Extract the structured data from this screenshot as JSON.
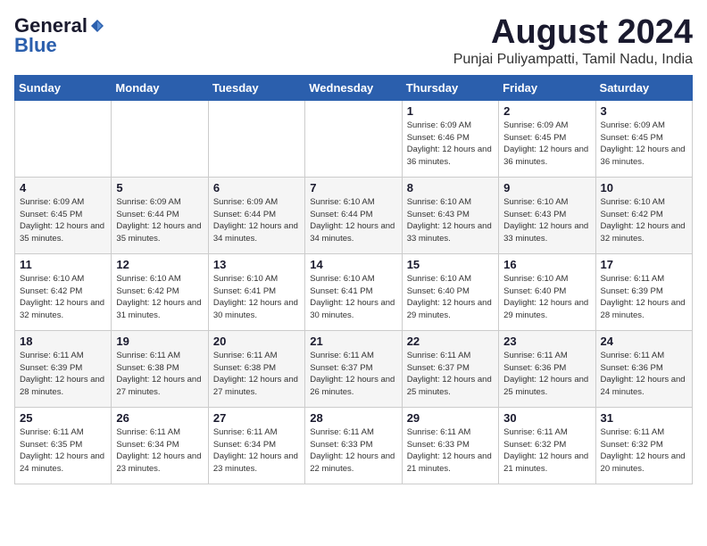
{
  "logo": {
    "general": "General",
    "blue": "Blue"
  },
  "title": "August 2024",
  "subtitle": "Punjai Puliyampatti, Tamil Nadu, India",
  "days_of_week": [
    "Sunday",
    "Monday",
    "Tuesday",
    "Wednesday",
    "Thursday",
    "Friday",
    "Saturday"
  ],
  "weeks": [
    [
      {
        "day": "",
        "info": ""
      },
      {
        "day": "",
        "info": ""
      },
      {
        "day": "",
        "info": ""
      },
      {
        "day": "",
        "info": ""
      },
      {
        "day": "1",
        "info": "Sunrise: 6:09 AM\nSunset: 6:46 PM\nDaylight: 12 hours\nand 36 minutes."
      },
      {
        "day": "2",
        "info": "Sunrise: 6:09 AM\nSunset: 6:45 PM\nDaylight: 12 hours\nand 36 minutes."
      },
      {
        "day": "3",
        "info": "Sunrise: 6:09 AM\nSunset: 6:45 PM\nDaylight: 12 hours\nand 36 minutes."
      }
    ],
    [
      {
        "day": "4",
        "info": "Sunrise: 6:09 AM\nSunset: 6:45 PM\nDaylight: 12 hours\nand 35 minutes."
      },
      {
        "day": "5",
        "info": "Sunrise: 6:09 AM\nSunset: 6:44 PM\nDaylight: 12 hours\nand 35 minutes."
      },
      {
        "day": "6",
        "info": "Sunrise: 6:09 AM\nSunset: 6:44 PM\nDaylight: 12 hours\nand 34 minutes."
      },
      {
        "day": "7",
        "info": "Sunrise: 6:10 AM\nSunset: 6:44 PM\nDaylight: 12 hours\nand 34 minutes."
      },
      {
        "day": "8",
        "info": "Sunrise: 6:10 AM\nSunset: 6:43 PM\nDaylight: 12 hours\nand 33 minutes."
      },
      {
        "day": "9",
        "info": "Sunrise: 6:10 AM\nSunset: 6:43 PM\nDaylight: 12 hours\nand 33 minutes."
      },
      {
        "day": "10",
        "info": "Sunrise: 6:10 AM\nSunset: 6:42 PM\nDaylight: 12 hours\nand 32 minutes."
      }
    ],
    [
      {
        "day": "11",
        "info": "Sunrise: 6:10 AM\nSunset: 6:42 PM\nDaylight: 12 hours\nand 32 minutes."
      },
      {
        "day": "12",
        "info": "Sunrise: 6:10 AM\nSunset: 6:42 PM\nDaylight: 12 hours\nand 31 minutes."
      },
      {
        "day": "13",
        "info": "Sunrise: 6:10 AM\nSunset: 6:41 PM\nDaylight: 12 hours\nand 30 minutes."
      },
      {
        "day": "14",
        "info": "Sunrise: 6:10 AM\nSunset: 6:41 PM\nDaylight: 12 hours\nand 30 minutes."
      },
      {
        "day": "15",
        "info": "Sunrise: 6:10 AM\nSunset: 6:40 PM\nDaylight: 12 hours\nand 29 minutes."
      },
      {
        "day": "16",
        "info": "Sunrise: 6:10 AM\nSunset: 6:40 PM\nDaylight: 12 hours\nand 29 minutes."
      },
      {
        "day": "17",
        "info": "Sunrise: 6:11 AM\nSunset: 6:39 PM\nDaylight: 12 hours\nand 28 minutes."
      }
    ],
    [
      {
        "day": "18",
        "info": "Sunrise: 6:11 AM\nSunset: 6:39 PM\nDaylight: 12 hours\nand 28 minutes."
      },
      {
        "day": "19",
        "info": "Sunrise: 6:11 AM\nSunset: 6:38 PM\nDaylight: 12 hours\nand 27 minutes."
      },
      {
        "day": "20",
        "info": "Sunrise: 6:11 AM\nSunset: 6:38 PM\nDaylight: 12 hours\nand 27 minutes."
      },
      {
        "day": "21",
        "info": "Sunrise: 6:11 AM\nSunset: 6:37 PM\nDaylight: 12 hours\nand 26 minutes."
      },
      {
        "day": "22",
        "info": "Sunrise: 6:11 AM\nSunset: 6:37 PM\nDaylight: 12 hours\nand 25 minutes."
      },
      {
        "day": "23",
        "info": "Sunrise: 6:11 AM\nSunset: 6:36 PM\nDaylight: 12 hours\nand 25 minutes."
      },
      {
        "day": "24",
        "info": "Sunrise: 6:11 AM\nSunset: 6:36 PM\nDaylight: 12 hours\nand 24 minutes."
      }
    ],
    [
      {
        "day": "25",
        "info": "Sunrise: 6:11 AM\nSunset: 6:35 PM\nDaylight: 12 hours\nand 24 minutes."
      },
      {
        "day": "26",
        "info": "Sunrise: 6:11 AM\nSunset: 6:34 PM\nDaylight: 12 hours\nand 23 minutes."
      },
      {
        "day": "27",
        "info": "Sunrise: 6:11 AM\nSunset: 6:34 PM\nDaylight: 12 hours\nand 23 minutes."
      },
      {
        "day": "28",
        "info": "Sunrise: 6:11 AM\nSunset: 6:33 PM\nDaylight: 12 hours\nand 22 minutes."
      },
      {
        "day": "29",
        "info": "Sunrise: 6:11 AM\nSunset: 6:33 PM\nDaylight: 12 hours\nand 21 minutes."
      },
      {
        "day": "30",
        "info": "Sunrise: 6:11 AM\nSunset: 6:32 PM\nDaylight: 12 hours\nand 21 minutes."
      },
      {
        "day": "31",
        "info": "Sunrise: 6:11 AM\nSunset: 6:32 PM\nDaylight: 12 hours\nand 20 minutes."
      }
    ]
  ]
}
